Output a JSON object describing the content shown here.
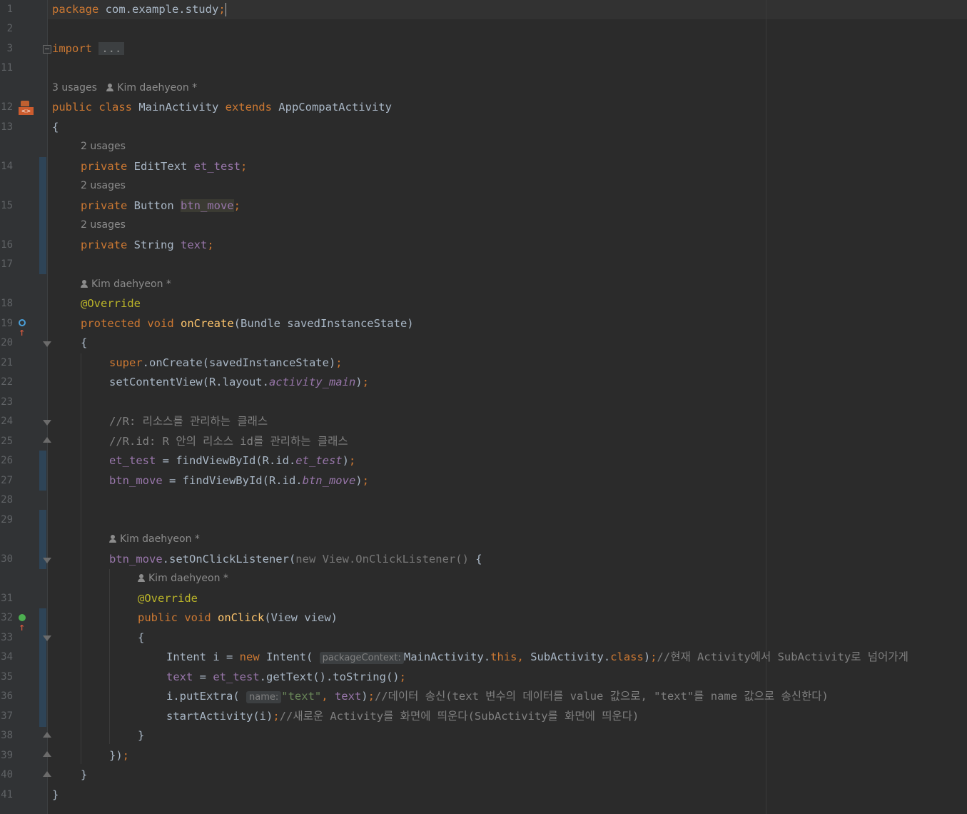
{
  "editor": {
    "file": {
      "package_kw": "package",
      "package_name": " com.example.study",
      "import_kw": "import",
      "import_fold": "..."
    },
    "line_numbers": [
      "1",
      "2",
      "3",
      "11",
      "12",
      "13",
      "14",
      "15",
      "16",
      "17",
      "18",
      "19",
      "20",
      "21",
      "22",
      "23",
      "24",
      "25",
      "26",
      "27",
      "28",
      "29",
      "30",
      "31",
      "32",
      "33",
      "34",
      "35",
      "36",
      "37",
      "38",
      "39",
      "40",
      "41"
    ],
    "inlays": {
      "class_usages": "3 usages",
      "author": "Kim daehyeon *",
      "field_usages": [
        "2 usages",
        "2 usages",
        "2 usages"
      ]
    },
    "class_decl": {
      "mods": "public class",
      "name": " MainActivity ",
      "extends": "extends",
      "parent": " AppCompatActivity"
    },
    "fields": [
      {
        "mod": "private",
        "type": " EditText ",
        "name": "et_test"
      },
      {
        "mod": "private",
        "type": " Button ",
        "name": "btn_move"
      },
      {
        "mod": "private",
        "type": " String ",
        "name": "text"
      }
    ],
    "method": {
      "annotation": "@Override",
      "mods": "protected void",
      "name": "onCreate",
      "params": "(Bundle savedInstanceState)"
    },
    "body": {
      "super_kw": "super",
      "super_call": ".onCreate(savedInstanceState)",
      "set_content": "setContentView(R.layout.",
      "layout_name": "activity_main",
      "comment_1": "//R: 리소스를 관리하는 클래스",
      "comment_2": "//R.id: R 안의 리소스 id를 관리하는 클래스",
      "find_et_pre": " = findViewById(R.id.",
      "find_btn_pre": " = findViewById(R.id.",
      "listener_call": ".setOnClickListener(",
      "listener_new": "new View.OnClickListener()",
      "onclick_mods": "public void",
      "onclick_name": "onClick",
      "onclick_params": "(View view)",
      "intent_type": "Intent i = ",
      "intent_new": "new",
      "intent_ctor": " Intent(",
      "hint_package_context": "packageContext:",
      "intent_arg1": "MainActivity.",
      "this_kw": "this",
      "intent_arg2": " SubActivity.",
      "class_kw": "class",
      "comment_3": "//현재 Activity에서 SubActivity로 넘어가게",
      "get_text": ".getText().toString()",
      "put_extra": "i.putExtra(",
      "hint_name": "name:",
      "extra_key": "\"text\"",
      "comment_4": "//데이터 송신(text 변수의 데이터를 value 값으로, \"text\"를 name 값으로 송신한다)",
      "start_activity": "startActivity(i)",
      "comment_5": "//새로운 Activity를 화면에 띄운다(SubActivity를 화면에 띄운다)"
    }
  }
}
